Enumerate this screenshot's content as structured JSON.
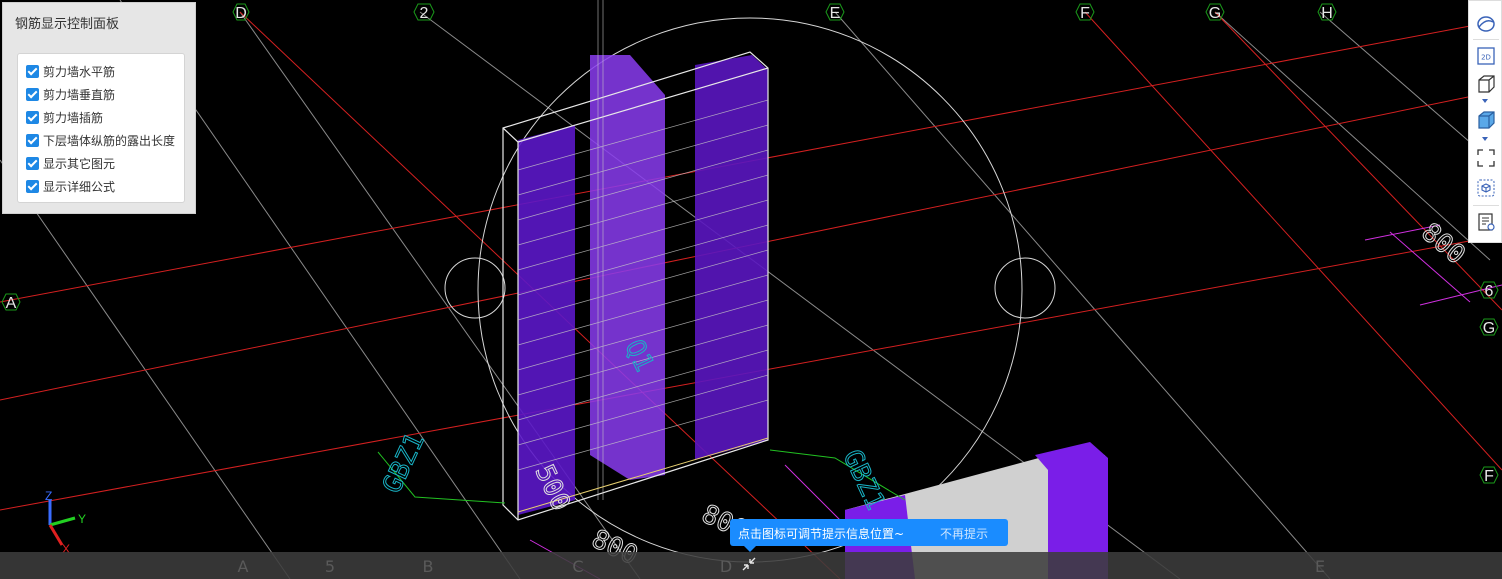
{
  "panel": {
    "title": "钢筋显示控制面板",
    "options": [
      {
        "label": "剪力墙水平筋",
        "checked": true
      },
      {
        "label": "剪力墙垂直筋",
        "checked": true
      },
      {
        "label": "剪力墙插筋",
        "checked": true
      },
      {
        "label": "下层墙体纵筋的露出长度",
        "checked": true
      },
      {
        "label": "显示其它图元",
        "checked": true
      },
      {
        "label": "显示详细公式",
        "checked": true
      }
    ]
  },
  "grid_labels": {
    "top": [
      "D",
      "2",
      "E",
      "F",
      "G",
      "H"
    ],
    "left": "A",
    "right": [
      "6",
      "G",
      "F"
    ],
    "bottom": [
      "A",
      "5",
      "B",
      "C",
      "D",
      "E"
    ]
  },
  "scene_labels": {
    "wall_left": "GBZ1",
    "wall_right": "GBZ1",
    "dim_500": "500",
    "dim_800_a": "800",
    "dim_800_b": "800",
    "dim_800_c": "800",
    "wall_code": "Q1"
  },
  "axis_triad": {
    "z": "Z",
    "y": "Y",
    "x": "X"
  },
  "toolbar": {
    "icons": [
      "orbit-icon",
      "view-2d-icon",
      "view-3d-box-icon",
      "view-3d-solid-icon",
      "fit-view-icon",
      "local-3d-icon",
      "property-list-icon"
    ]
  },
  "tip": {
    "message": "点击图标可调节提示信息位置~",
    "dismiss": "不再提示"
  },
  "colors": {
    "grid_red": "#e02020",
    "grid_gray": "#9a9a9a",
    "axis_bubble": "#1a9a1a",
    "wall_purple": "#7a1ee8",
    "accent_blue": "#1a8cff",
    "label_cyan": "#19b5c7"
  }
}
